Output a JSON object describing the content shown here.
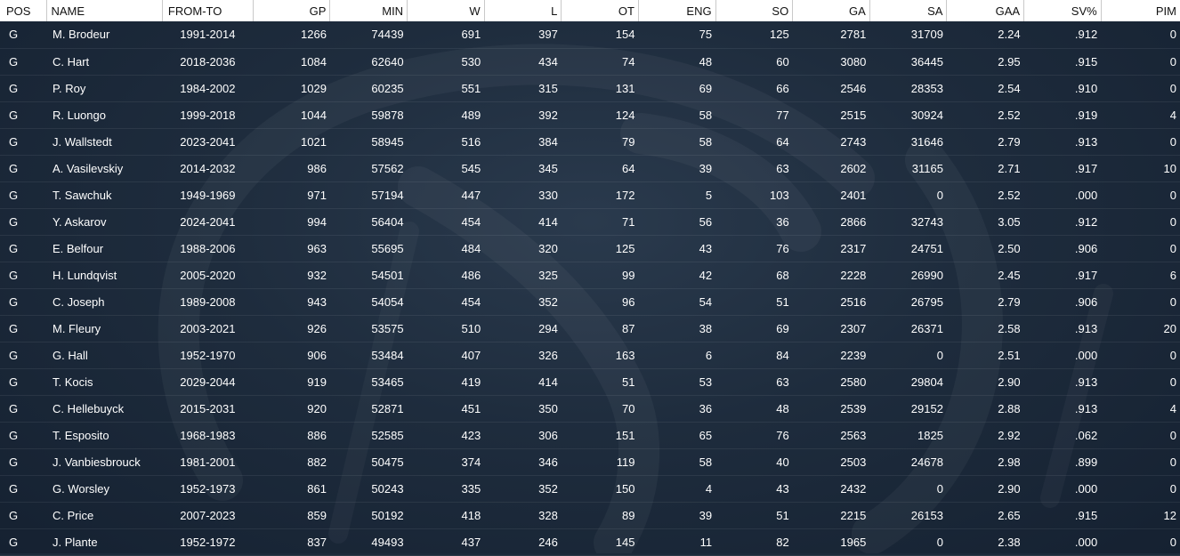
{
  "columns": [
    {
      "key": "pos",
      "label": "POS"
    },
    {
      "key": "name",
      "label": "NAME"
    },
    {
      "key": "fromto",
      "label": "FROM-TO"
    },
    {
      "key": "gp",
      "label": "GP"
    },
    {
      "key": "min",
      "label": "MIN"
    },
    {
      "key": "w",
      "label": "W"
    },
    {
      "key": "l",
      "label": "L"
    },
    {
      "key": "ot",
      "label": "OT"
    },
    {
      "key": "eng",
      "label": "ENG"
    },
    {
      "key": "so",
      "label": "SO"
    },
    {
      "key": "ga",
      "label": "GA"
    },
    {
      "key": "sa",
      "label": "SA"
    },
    {
      "key": "gaa",
      "label": "GAA"
    },
    {
      "key": "svp",
      "label": "SV%"
    },
    {
      "key": "pim",
      "label": "PIM"
    }
  ],
  "rows": [
    {
      "pos": "G",
      "name": "M. Brodeur",
      "fromto": "1991-2014",
      "gp": "1266",
      "min": "74439",
      "w": "691",
      "l": "397",
      "ot": "154",
      "eng": "75",
      "so": "125",
      "ga": "2781",
      "sa": "31709",
      "gaa": "2.24",
      "svp": ".912",
      "pim": "0"
    },
    {
      "pos": "G",
      "name": "C. Hart",
      "fromto": "2018-2036",
      "gp": "1084",
      "min": "62640",
      "w": "530",
      "l": "434",
      "ot": "74",
      "eng": "48",
      "so": "60",
      "ga": "3080",
      "sa": "36445",
      "gaa": "2.95",
      "svp": ".915",
      "pim": "0"
    },
    {
      "pos": "G",
      "name": "P. Roy",
      "fromto": "1984-2002",
      "gp": "1029",
      "min": "60235",
      "w": "551",
      "l": "315",
      "ot": "131",
      "eng": "69",
      "so": "66",
      "ga": "2546",
      "sa": "28353",
      "gaa": "2.54",
      "svp": ".910",
      "pim": "0"
    },
    {
      "pos": "G",
      "name": "R. Luongo",
      "fromto": "1999-2018",
      "gp": "1044",
      "min": "59878",
      "w": "489",
      "l": "392",
      "ot": "124",
      "eng": "58",
      "so": "77",
      "ga": "2515",
      "sa": "30924",
      "gaa": "2.52",
      "svp": ".919",
      "pim": "4"
    },
    {
      "pos": "G",
      "name": "J. Wallstedt",
      "fromto": "2023-2041",
      "gp": "1021",
      "min": "58945",
      "w": "516",
      "l": "384",
      "ot": "79",
      "eng": "58",
      "so": "64",
      "ga": "2743",
      "sa": "31646",
      "gaa": "2.79",
      "svp": ".913",
      "pim": "0"
    },
    {
      "pos": "G",
      "name": "A. Vasilevskiy",
      "fromto": "2014-2032",
      "gp": "986",
      "min": "57562",
      "w": "545",
      "l": "345",
      "ot": "64",
      "eng": "39",
      "so": "63",
      "ga": "2602",
      "sa": "31165",
      "gaa": "2.71",
      "svp": ".917",
      "pim": "10"
    },
    {
      "pos": "G",
      "name": "T. Sawchuk",
      "fromto": "1949-1969",
      "gp": "971",
      "min": "57194",
      "w": "447",
      "l": "330",
      "ot": "172",
      "eng": "5",
      "so": "103",
      "ga": "2401",
      "sa": "0",
      "gaa": "2.52",
      "svp": ".000",
      "pim": "0"
    },
    {
      "pos": "G",
      "name": "Y. Askarov",
      "fromto": "2024-2041",
      "gp": "994",
      "min": "56404",
      "w": "454",
      "l": "414",
      "ot": "71",
      "eng": "56",
      "so": "36",
      "ga": "2866",
      "sa": "32743",
      "gaa": "3.05",
      "svp": ".912",
      "pim": "0"
    },
    {
      "pos": "G",
      "name": "E. Belfour",
      "fromto": "1988-2006",
      "gp": "963",
      "min": "55695",
      "w": "484",
      "l": "320",
      "ot": "125",
      "eng": "43",
      "so": "76",
      "ga": "2317",
      "sa": "24751",
      "gaa": "2.50",
      "svp": ".906",
      "pim": "0"
    },
    {
      "pos": "G",
      "name": "H. Lundqvist",
      "fromto": "2005-2020",
      "gp": "932",
      "min": "54501",
      "w": "486",
      "l": "325",
      "ot": "99",
      "eng": "42",
      "so": "68",
      "ga": "2228",
      "sa": "26990",
      "gaa": "2.45",
      "svp": ".917",
      "pim": "6"
    },
    {
      "pos": "G",
      "name": "C. Joseph",
      "fromto": "1989-2008",
      "gp": "943",
      "min": "54054",
      "w": "454",
      "l": "352",
      "ot": "96",
      "eng": "54",
      "so": "51",
      "ga": "2516",
      "sa": "26795",
      "gaa": "2.79",
      "svp": ".906",
      "pim": "0"
    },
    {
      "pos": "G",
      "name": "M. Fleury",
      "fromto": "2003-2021",
      "gp": "926",
      "min": "53575",
      "w": "510",
      "l": "294",
      "ot": "87",
      "eng": "38",
      "so": "69",
      "ga": "2307",
      "sa": "26371",
      "gaa": "2.58",
      "svp": ".913",
      "pim": "20"
    },
    {
      "pos": "G",
      "name": "G. Hall",
      "fromto": "1952-1970",
      "gp": "906",
      "min": "53484",
      "w": "407",
      "l": "326",
      "ot": "163",
      "eng": "6",
      "so": "84",
      "ga": "2239",
      "sa": "0",
      "gaa": "2.51",
      "svp": ".000",
      "pim": "0"
    },
    {
      "pos": "G",
      "name": "T. Kocis",
      "fromto": "2029-2044",
      "gp": "919",
      "min": "53465",
      "w": "419",
      "l": "414",
      "ot": "51",
      "eng": "53",
      "so": "63",
      "ga": "2580",
      "sa": "29804",
      "gaa": "2.90",
      "svp": ".913",
      "pim": "0"
    },
    {
      "pos": "G",
      "name": "C. Hellebuyck",
      "fromto": "2015-2031",
      "gp": "920",
      "min": "52871",
      "w": "451",
      "l": "350",
      "ot": "70",
      "eng": "36",
      "so": "48",
      "ga": "2539",
      "sa": "29152",
      "gaa": "2.88",
      "svp": ".913",
      "pim": "4"
    },
    {
      "pos": "G",
      "name": "T. Esposito",
      "fromto": "1968-1983",
      "gp": "886",
      "min": "52585",
      "w": "423",
      "l": "306",
      "ot": "151",
      "eng": "65",
      "so": "76",
      "ga": "2563",
      "sa": "1825",
      "gaa": "2.92",
      "svp": ".062",
      "pim": "0"
    },
    {
      "pos": "G",
      "name": "J. Vanbiesbrouck",
      "fromto": "1981-2001",
      "gp": "882",
      "min": "50475",
      "w": "374",
      "l": "346",
      "ot": "119",
      "eng": "58",
      "so": "40",
      "ga": "2503",
      "sa": "24678",
      "gaa": "2.98",
      "svp": ".899",
      "pim": "0"
    },
    {
      "pos": "G",
      "name": "G. Worsley",
      "fromto": "1952-1973",
      "gp": "861",
      "min": "50243",
      "w": "335",
      "l": "352",
      "ot": "150",
      "eng": "4",
      "so": "43",
      "ga": "2432",
      "sa": "0",
      "gaa": "2.90",
      "svp": ".000",
      "pim": "0"
    },
    {
      "pos": "G",
      "name": "C. Price",
      "fromto": "2007-2023",
      "gp": "859",
      "min": "50192",
      "w": "418",
      "l": "328",
      "ot": "89",
      "eng": "39",
      "so": "51",
      "ga": "2215",
      "sa": "26153",
      "gaa": "2.65",
      "svp": ".915",
      "pim": "12"
    },
    {
      "pos": "G",
      "name": "J. Plante",
      "fromto": "1952-1972",
      "gp": "837",
      "min": "49493",
      "w": "437",
      "l": "246",
      "ot": "145",
      "eng": "11",
      "so": "82",
      "ga": "1965",
      "sa": "0",
      "gaa": "2.38",
      "svp": ".000",
      "pim": "0"
    }
  ],
  "colors": {
    "background": "#1c2a3a",
    "header_bg": "#ffffff",
    "header_text": "#111111",
    "row_text": "#ffffff"
  },
  "decoration": {
    "watermark": "league-logo-watermark"
  }
}
